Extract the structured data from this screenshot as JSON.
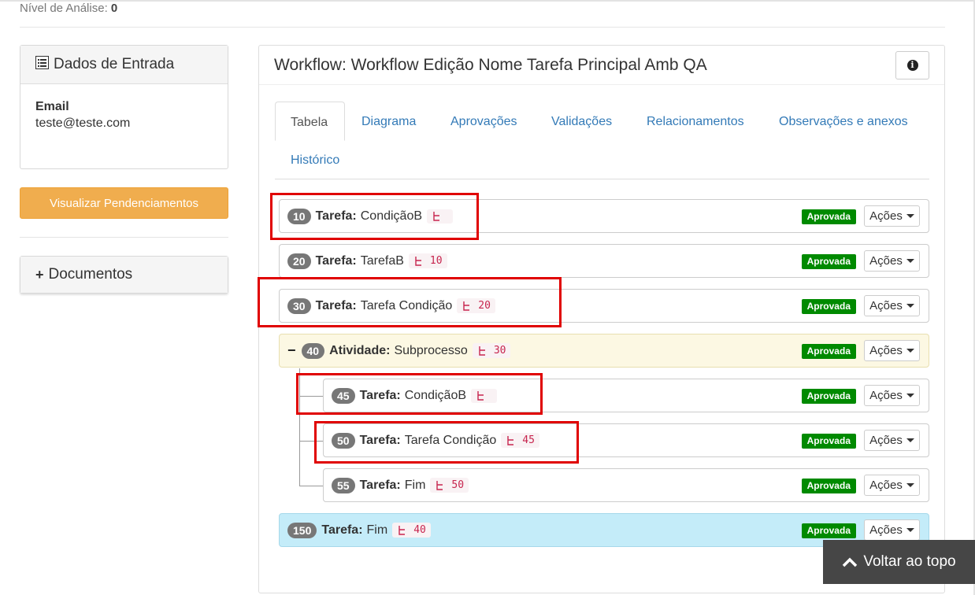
{
  "nivel": {
    "label": "Nível de Análise:",
    "value": "0"
  },
  "dados_entrada": {
    "title": "Dados de Entrada",
    "field_label": "Email",
    "field_value": "teste@teste.com"
  },
  "pendencias_button": "Visualizar Pendenciamentos",
  "documentos": {
    "title": "Documentos",
    "toggle": "+"
  },
  "workflow": {
    "title": "Workflow: Workflow Edição Nome Tarefa Principal Amb QA",
    "tabs": [
      "Tabela",
      "Diagrama",
      "Aprovações",
      "Validações",
      "Relacionamentos",
      "Observações e anexos",
      "Histórico"
    ],
    "active_tab": "Tabela",
    "status_text": "Aprovada",
    "actions_label": "Ações",
    "rows": [
      {
        "num": "10",
        "kind": "Tarefa:",
        "name": "CondiçãoB",
        "dep": "",
        "highlighted": true
      },
      {
        "num": "20",
        "kind": "Tarefa:",
        "name": "TarefaB",
        "dep": "10",
        "highlighted": false
      },
      {
        "num": "30",
        "kind": "Tarefa:",
        "name": "Tarefa Condição",
        "dep": "20",
        "highlighted": true
      },
      {
        "num": "40",
        "kind": "Atividade:",
        "name": "Subprocesso",
        "dep": "30",
        "toggle": "−",
        "highlighted": false
      },
      {
        "num": "45",
        "kind": "Tarefa:",
        "name": "CondiçãoB",
        "dep": "",
        "highlighted": true
      },
      {
        "num": "50",
        "kind": "Tarefa:",
        "name": "Tarefa Condição",
        "dep": "45",
        "highlighted": true
      },
      {
        "num": "55",
        "kind": "Tarefa:",
        "name": "Fim",
        "dep": "50",
        "highlighted": false
      },
      {
        "num": "150",
        "kind": "Tarefa:",
        "name": "Fim",
        "dep": "40",
        "highlighted": false
      }
    ]
  },
  "voltar_topo": "Voltar ao topo",
  "colors": {
    "warning": "#f0ad4e",
    "approved": "#008a00",
    "subprocess_bg": "#fcf8e3",
    "final_bg": "#c4ecf9",
    "highlight": "#e00000",
    "link": "#337ab7"
  },
  "icons": [
    "list-alt-icon",
    "info-circle-icon",
    "sitemap-icon",
    "caret-down-icon",
    "chevron-up-icon"
  ]
}
